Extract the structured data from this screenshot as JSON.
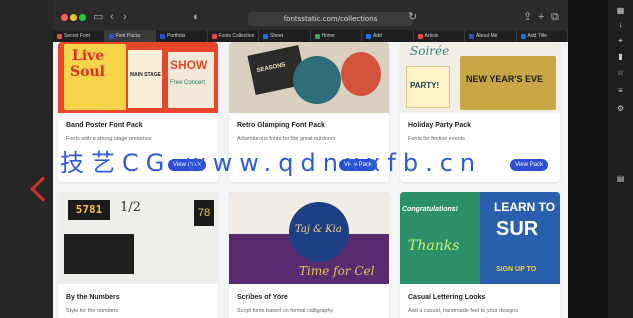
{
  "browser": {
    "url": "fontsstatic.com/collections",
    "tabs": [
      {
        "label": "Secret Font",
        "color": "#e84c3d"
      },
      {
        "label": "Font Packs",
        "color": "#2a4fd4"
      },
      {
        "label": "Portfolio",
        "color": "#2a4fd4"
      },
      {
        "label": "Fonts Collection",
        "color": "#e84c3d"
      },
      {
        "label": "Sheet",
        "color": "#1a73e8"
      },
      {
        "label": "Home",
        "color": "#34a853"
      },
      {
        "label": "Add",
        "color": "#1a73e8"
      },
      {
        "label": "Article",
        "color": "#e84c3d"
      },
      {
        "label": "About Me",
        "color": "#2a4fd4"
      },
      {
        "label": "Add Title",
        "color": "#1a73e8"
      }
    ]
  },
  "cards": [
    {
      "title": "Band Poster Font Pack",
      "desc": "Fonts with a strong stage presence",
      "button": "View Pack",
      "thumb": {
        "line1": "Live",
        "line2": "Soul",
        "sub": "MAIN STAGE",
        "right": "SHOW",
        "right_sub": "Free Concert"
      }
    },
    {
      "title": "Retro Glamping Font Pack",
      "desc": "Adventurous fonts for the great outdoors",
      "button": "View Pack",
      "thumb": {
        "badge": "SEASONS"
      }
    },
    {
      "title": "Holiday Party Pack",
      "desc": "Fonts for festive events",
      "button": "View Pack",
      "thumb": {
        "soiree": "Soirée",
        "party": "PARTY!",
        "nye": "NEW YEAR'S EVE"
      }
    },
    {
      "title": "By the Numbers",
      "desc": "Style for the numbers",
      "button": "",
      "thumb": {
        "n1": "5781",
        "n2": "1/2",
        "n3": "78"
      }
    },
    {
      "title": "Scribes of Yore",
      "desc": "Script fonts based on formal calligraphy",
      "button": "",
      "thumb": {
        "names": "Taj & Kia",
        "time": "Time for Cel"
      }
    },
    {
      "title": "Casual Lettering Looks",
      "desc": "Add a casual, handmade feel to your designs",
      "button": "",
      "thumb": {
        "c1": "Congratulations!",
        "c2": "Thanks",
        "c3": "LEARN TO",
        "c4": "SUR",
        "c5": "SIGN UP TO"
      }
    }
  ],
  "watermark": "技艺CG  www.qdnxxfb.cn"
}
